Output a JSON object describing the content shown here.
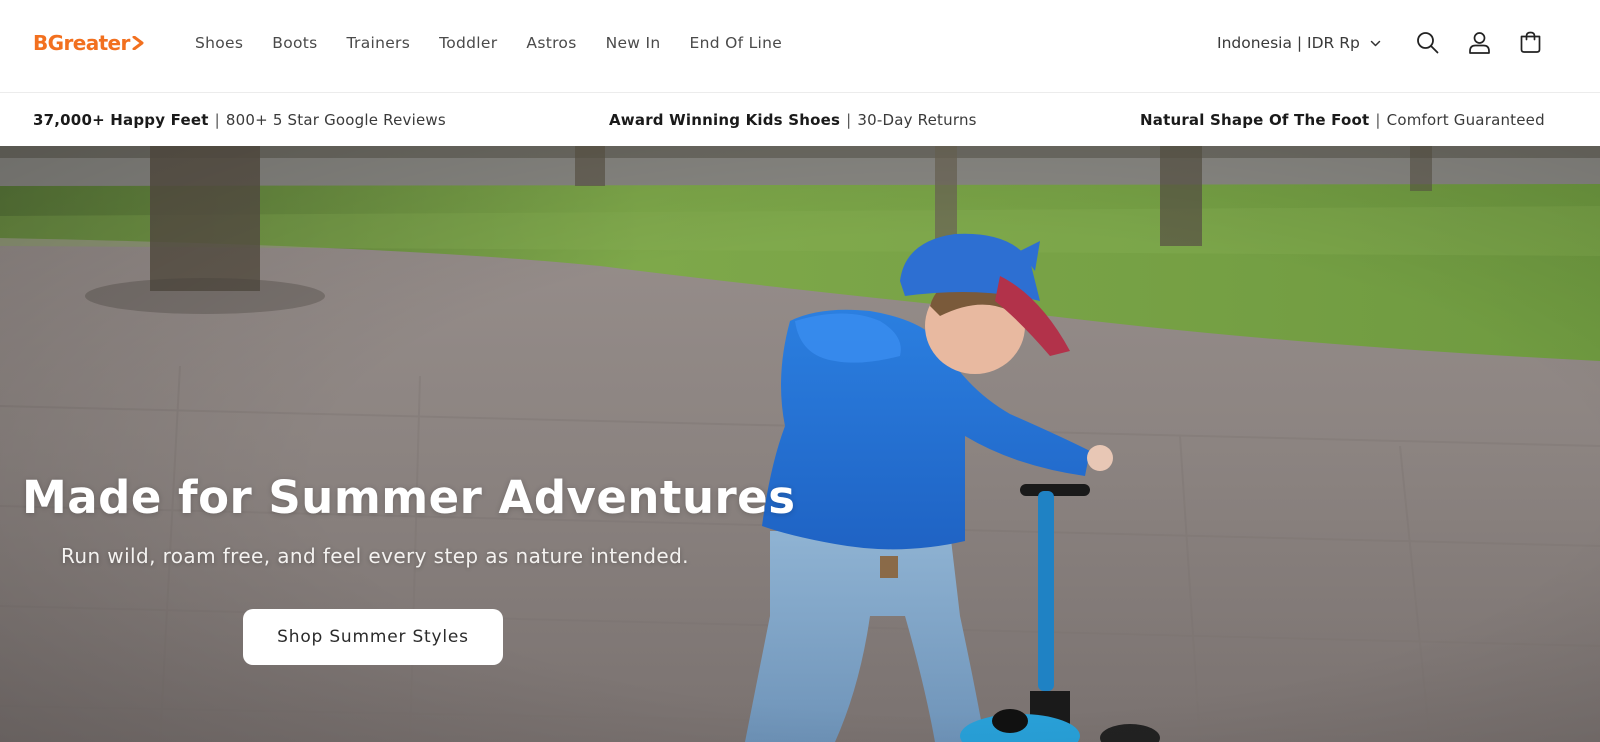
{
  "brand": {
    "logo_text": "BGreater",
    "accent_color": "#f2701f"
  },
  "nav": {
    "items": [
      {
        "label": "Shoes"
      },
      {
        "label": "Boots"
      },
      {
        "label": "Trainers"
      },
      {
        "label": "Toddler"
      },
      {
        "label": "Astros"
      },
      {
        "label": "New In"
      },
      {
        "label": "End Of Line"
      }
    ]
  },
  "header": {
    "locale_label": "Indonesia | IDR Rp",
    "icons": [
      "search-icon",
      "account-icon",
      "cart-icon",
      "chevron-down-icon"
    ]
  },
  "announcement": [
    {
      "bold": "37,000+ Happy Feet",
      "separator": "|",
      "text": "800+ 5 Star Google Reviews"
    },
    {
      "bold": "Award Winning Kids Shoes",
      "separator": "|",
      "text": "30-Day Returns"
    },
    {
      "bold": "Natural Shape Of The Foot",
      "separator": "|",
      "text": "Comfort Guaranteed"
    }
  ],
  "hero": {
    "title": "Made for Summer Adventures",
    "subtitle": "Run wild, roam free, and feel every step as nature intended.",
    "cta_label": "Shop Summer Styles"
  }
}
